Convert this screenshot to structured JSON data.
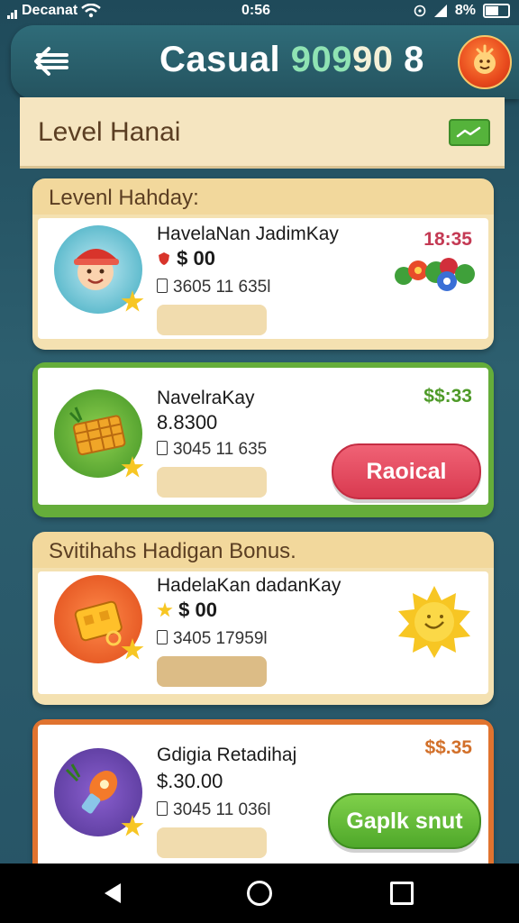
{
  "status_bar": {
    "carrier": "Decanat",
    "time": "0:56",
    "battery": "8%"
  },
  "header": {
    "back_label": "back",
    "title": "Casual",
    "score_a": "909",
    "score_b": "90",
    "score_c": "8",
    "avatar_icon": "sun-mascot-icon"
  },
  "level_banner": {
    "title": "Level  Hanai",
    "chart_icon": "trend-chart-icon"
  },
  "cards": [
    {
      "section": "Levenl Hahday:",
      "title": "HavelaNan JadimKay",
      "price": "$ 00",
      "code": "3605 11 635l",
      "amount": "18:35",
      "icon": "mascot-hat-icon",
      "decoration": "flower-bouquet-icon",
      "accent": "#c43a54"
    },
    {
      "title": "NavelraKay",
      "price": "8.8300",
      "code": "3045 11 635",
      "amount": "$$:33",
      "icon": "treasure-chest-icon",
      "button": "Raoical",
      "accent": "#5fa833"
    },
    {
      "section": "Svitihahs Hadigan Bonus.",
      "title": "HadelaKan dadanKay",
      "price": "$ 00",
      "code": "3405 17959l",
      "icon": "gold-box-icon",
      "decoration": "smiling-sun-icon",
      "accent": "#d3702d"
    },
    {
      "title": "Gdigia Retadihaj",
      "price": "$.30.00",
      "code": "3045 11 036l",
      "amount": "$$.35",
      "icon": "rocket-torch-icon",
      "button": "Gaplk snut",
      "accent": "#d3702d"
    }
  ],
  "colors": {
    "header_bg": "#2f6c79",
    "banner_bg": "#f5e5c0",
    "red_button": "#e8475c",
    "green_button": "#63bb36"
  },
  "navbar": {
    "back": "nav-back-icon",
    "home": "nav-home-icon",
    "recent": "nav-recent-icon"
  }
}
